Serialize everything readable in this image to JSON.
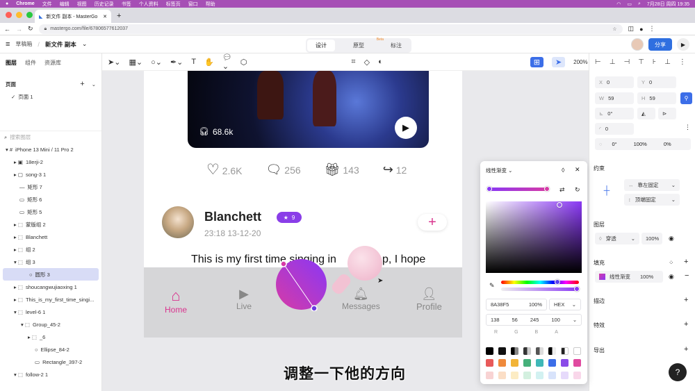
{
  "menubar": {
    "items": [
      "Chrome",
      "文件",
      "编辑",
      "视图",
      "历史记录",
      "书签",
      "个人资料",
      "标签页",
      "窗口",
      "帮助"
    ],
    "clock": "7月28日 周四 19:35"
  },
  "browser": {
    "tab_title": "新文件 副本 - MasterGo",
    "url": "mastergo.com/file/67806577612037"
  },
  "header": {
    "breadcrumb_root": "草稿箱",
    "file_name": "新文件 副本",
    "modes": [
      "设计",
      "原型",
      "标注"
    ],
    "beta": "Beta",
    "share": "分享"
  },
  "left_panel": {
    "tabs": [
      "图层",
      "组件",
      "资源库"
    ],
    "pages_title": "页面",
    "page1": "页面 1",
    "search_placeholder": "搜索图层",
    "layers": [
      "iPhone 13 Mini / 11 Pro 2",
      "18erji-2",
      "song-3 1",
      "矩形 7",
      "矩形 6",
      "矩形 5",
      "蒙版组 2",
      "Blanchett",
      "组 2",
      "组 3",
      "圆形 3",
      "shoucangwujiaoxing 1",
      "This_is_my_first_time_singi...",
      "level-6 1",
      "Group_45-2",
      "_6",
      "Ellipse_84-2",
      "Rectangle_397-2",
      "follow-2 1"
    ]
  },
  "toolbar": {
    "zoom": "200%"
  },
  "artboard": {
    "plays": "68.6k",
    "likes": "2.6K",
    "comments": "256",
    "gifts": "143",
    "shares": "12",
    "user": "Blanchett",
    "badge": "9",
    "time": "23:18 13-12-20",
    "post_text": "This is my first time singing in",
    "post_tail": "p, I hope",
    "nav": [
      "Home",
      "Live",
      "Messages",
      "Profile"
    ]
  },
  "right_panel": {
    "x": "0",
    "y": "0",
    "w": "59",
    "h": "59",
    "rot": "0°",
    "radius": "0",
    "r1": "0°",
    "r2": "100%",
    "r3": "0%",
    "constraints_title": "约束",
    "c_h": "靠左固定",
    "c_v": "顶端固定",
    "layer_title": "图层",
    "blend": "穿透",
    "opacity": "100%",
    "fill_title": "填充",
    "fill_type": "线性渐变",
    "fill_opacity": "100%",
    "stroke_title": "描边",
    "effect_title": "特效",
    "export_title": "导出"
  },
  "color_popup": {
    "title": "线性渐变",
    "hex": "8A38F5",
    "alpha": "100%",
    "mode": "HEX",
    "r": "138",
    "g": "56",
    "b": "245",
    "a": "100",
    "lbl_r": "R",
    "lbl_g": "G",
    "lbl_b": "B",
    "lbl_a": "A"
  },
  "caption": "调整一下他的方向",
  "colors": {
    "accent": "#d9348e",
    "gradient_start": "#d63aa6",
    "gradient_end": "#8a38f5",
    "brand": "#2f6fe0"
  }
}
